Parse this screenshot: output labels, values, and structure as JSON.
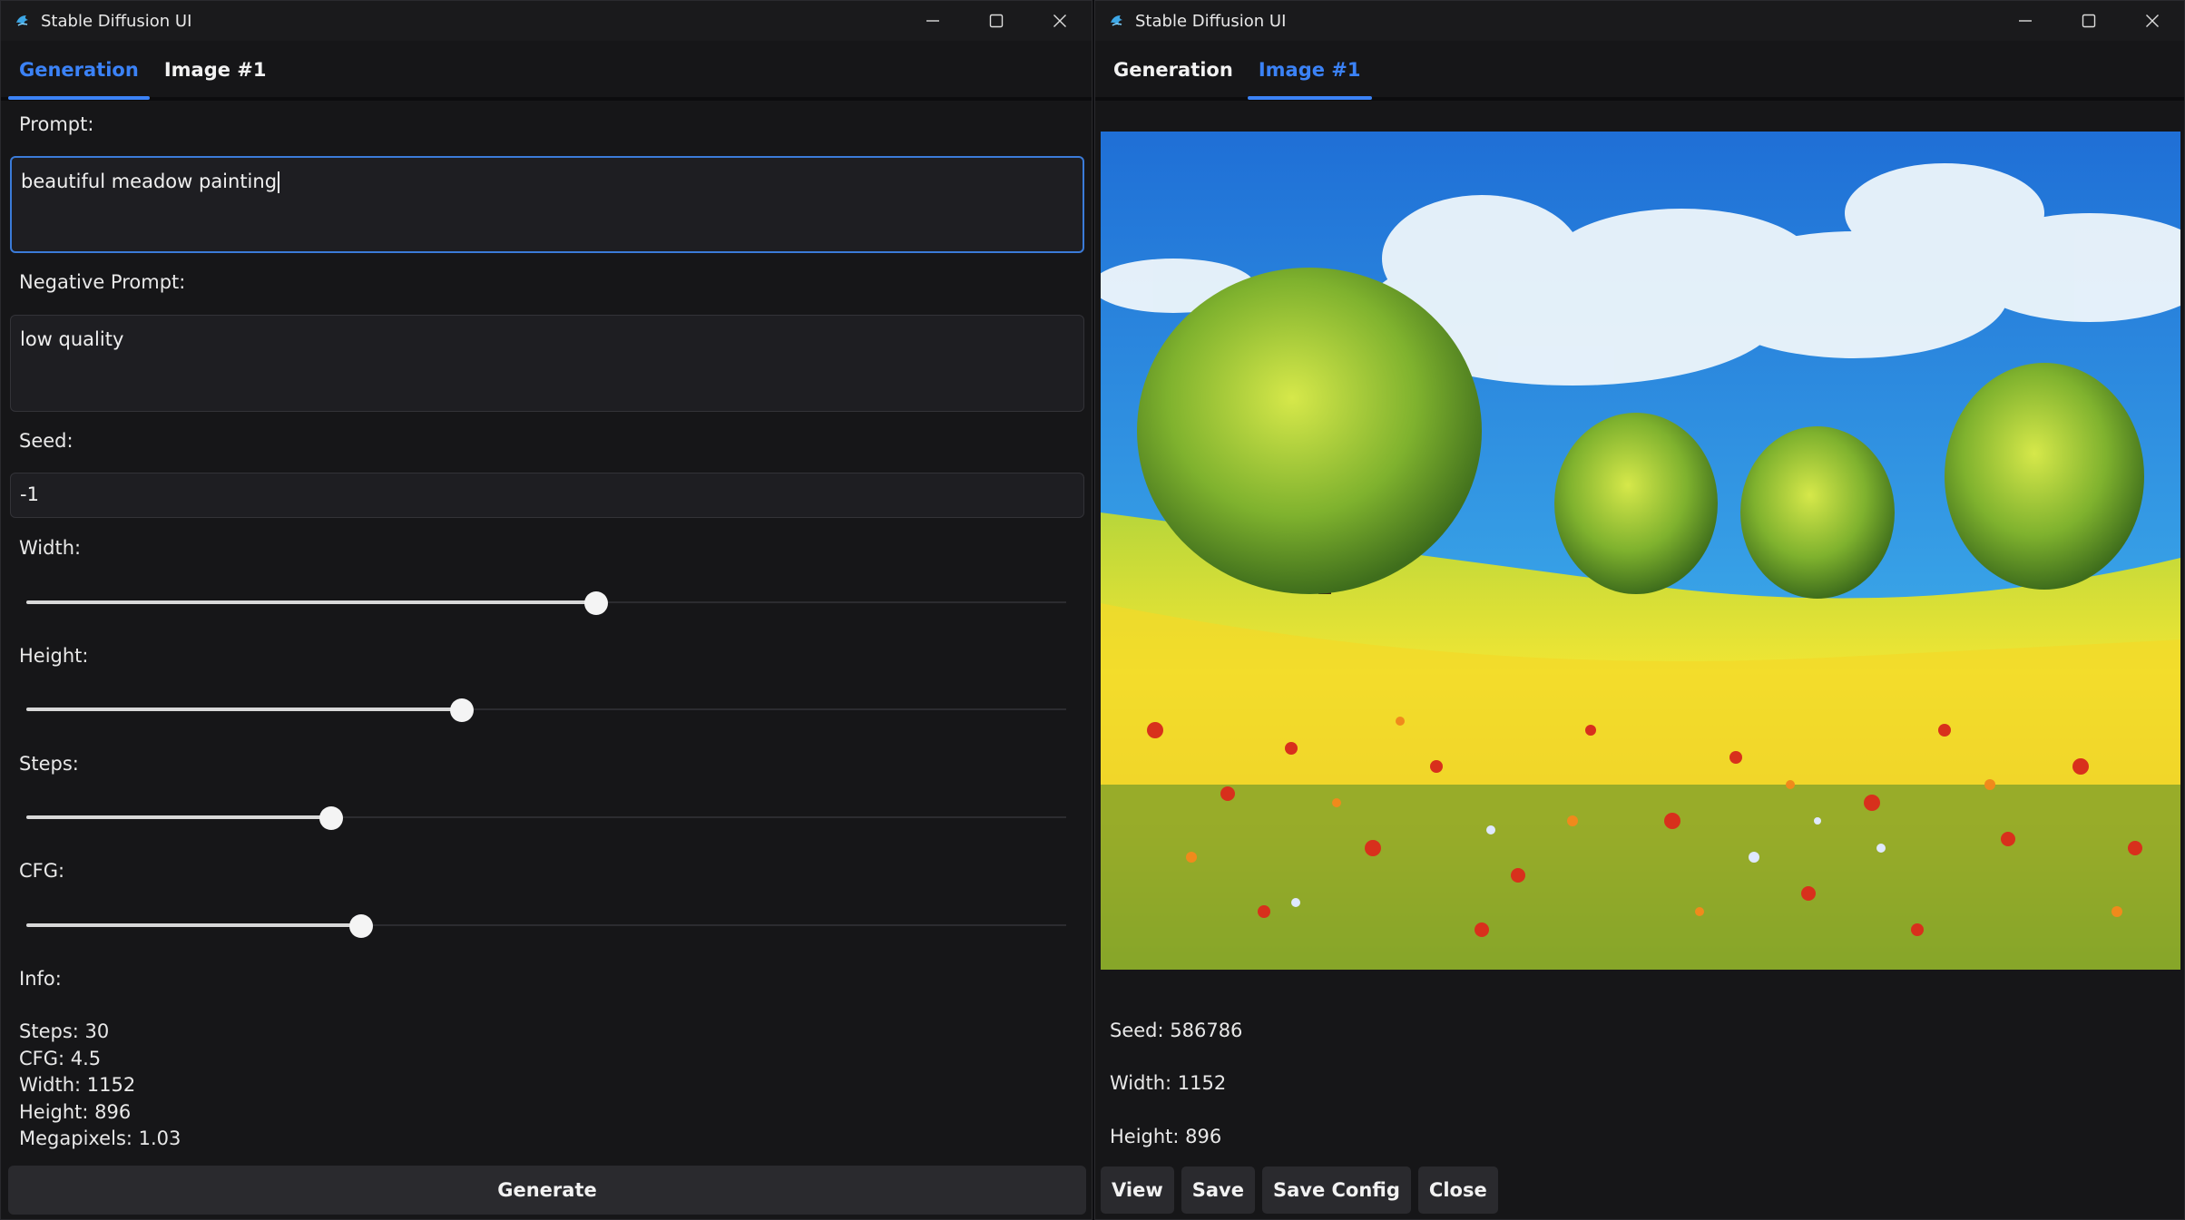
{
  "colors": {
    "accent": "#3b82f6",
    "window_bg": "#161618",
    "field_bg": "#1e1e22",
    "button_bg": "#2a2a2e"
  },
  "left": {
    "window_title": "Stable Diffusion UI",
    "tabs": [
      {
        "label": "Generation",
        "active": true
      },
      {
        "label": "Image #1",
        "active": false
      }
    ],
    "prompt": {
      "label": "Prompt:",
      "value": "beautiful meadow painting"
    },
    "negative_prompt": {
      "label": "Negative Prompt:",
      "value": "low quality"
    },
    "seed": {
      "label": "Seed:",
      "value": "-1"
    },
    "sliders": {
      "width": {
        "label": "Width:",
        "fraction": 0.548
      },
      "height": {
        "label": "Height:",
        "fraction": 0.419
      },
      "steps": {
        "label": "Steps:",
        "fraction": 0.293
      },
      "cfg": {
        "label": "CFG:",
        "fraction": 0.322
      }
    },
    "info": {
      "label": "Info:",
      "lines": [
        "Steps: 30",
        "CFG: 4.5",
        "Width: 1152",
        "Height: 896",
        "Megapixels: 1.03"
      ]
    },
    "generate_label": "Generate"
  },
  "right": {
    "window_title": "Stable Diffusion UI",
    "tabs": [
      {
        "label": "Generation",
        "active": false
      },
      {
        "label": "Image #1",
        "active": true
      }
    ],
    "image_icon": "meadow-painting",
    "seed_text": "Seed: 586786",
    "width_text": "Width: 1152",
    "height_text": "Height: 896",
    "buttons": {
      "view": "View",
      "save": "Save",
      "save_config": "Save Config",
      "close": "Close"
    }
  }
}
